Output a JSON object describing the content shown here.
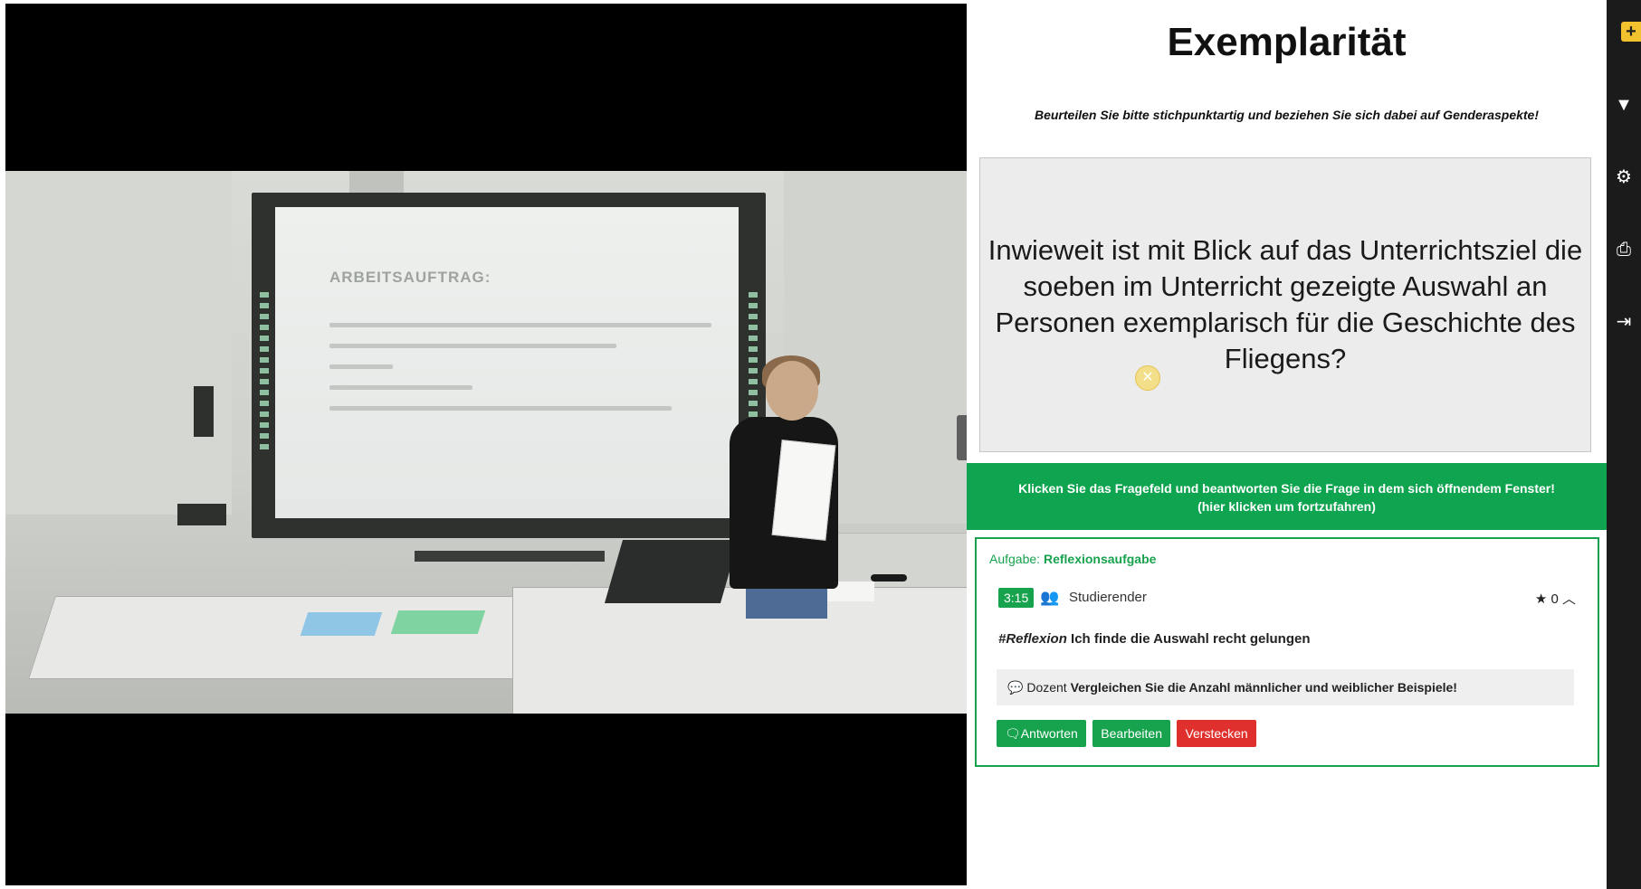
{
  "video": {
    "slide": {
      "title": "ARBEITSAUFTRAG:"
    }
  },
  "panel": {
    "title": "Exemplarität",
    "instruction": "Beurteilen Sie bitte stichpunktartig und beziehen Sie sich dabei auf Genderaspekte!",
    "question": "Inwieweit ist mit Blick auf das Unterrichtsziel die soeben im Unterricht gezeigte Auswahl an Personen exemplarisch für die Geschichte des Fliegens?",
    "banner_line1": "Klicken Sie das Fragefeld und beantworten Sie die Frage in dem sich öffnendem Fenster!",
    "banner_line2": "(hier klicken um fortzufahren)",
    "answer": {
      "task_label": "Aufgabe:",
      "task_value": "Reflexionsaufgabe",
      "time": "3:15",
      "role": "Studierender",
      "stars_count": "0",
      "hashtag": "#Reflexion",
      "text": "Ich finde die Auswahl recht gelungen",
      "comment_author": "Dozent",
      "comment_text": "Vergleichen Sie die Anzahl männlicher und weiblicher Beispiele!",
      "btn_reply": "Antworten",
      "btn_edit": "Bearbeiten",
      "btn_hide": "Verstecken"
    }
  },
  "toolbar": {
    "icons": [
      "plus-icon",
      "filter-icon",
      "gear-icon",
      "print-icon",
      "logout-icon"
    ]
  },
  "colors": {
    "accent_green": "#17a24e",
    "banner_green": "#0fa450",
    "danger_red": "#e0302e",
    "toolbar_bg": "#1b1b1b",
    "plus_yellow": "#f2c12e"
  }
}
